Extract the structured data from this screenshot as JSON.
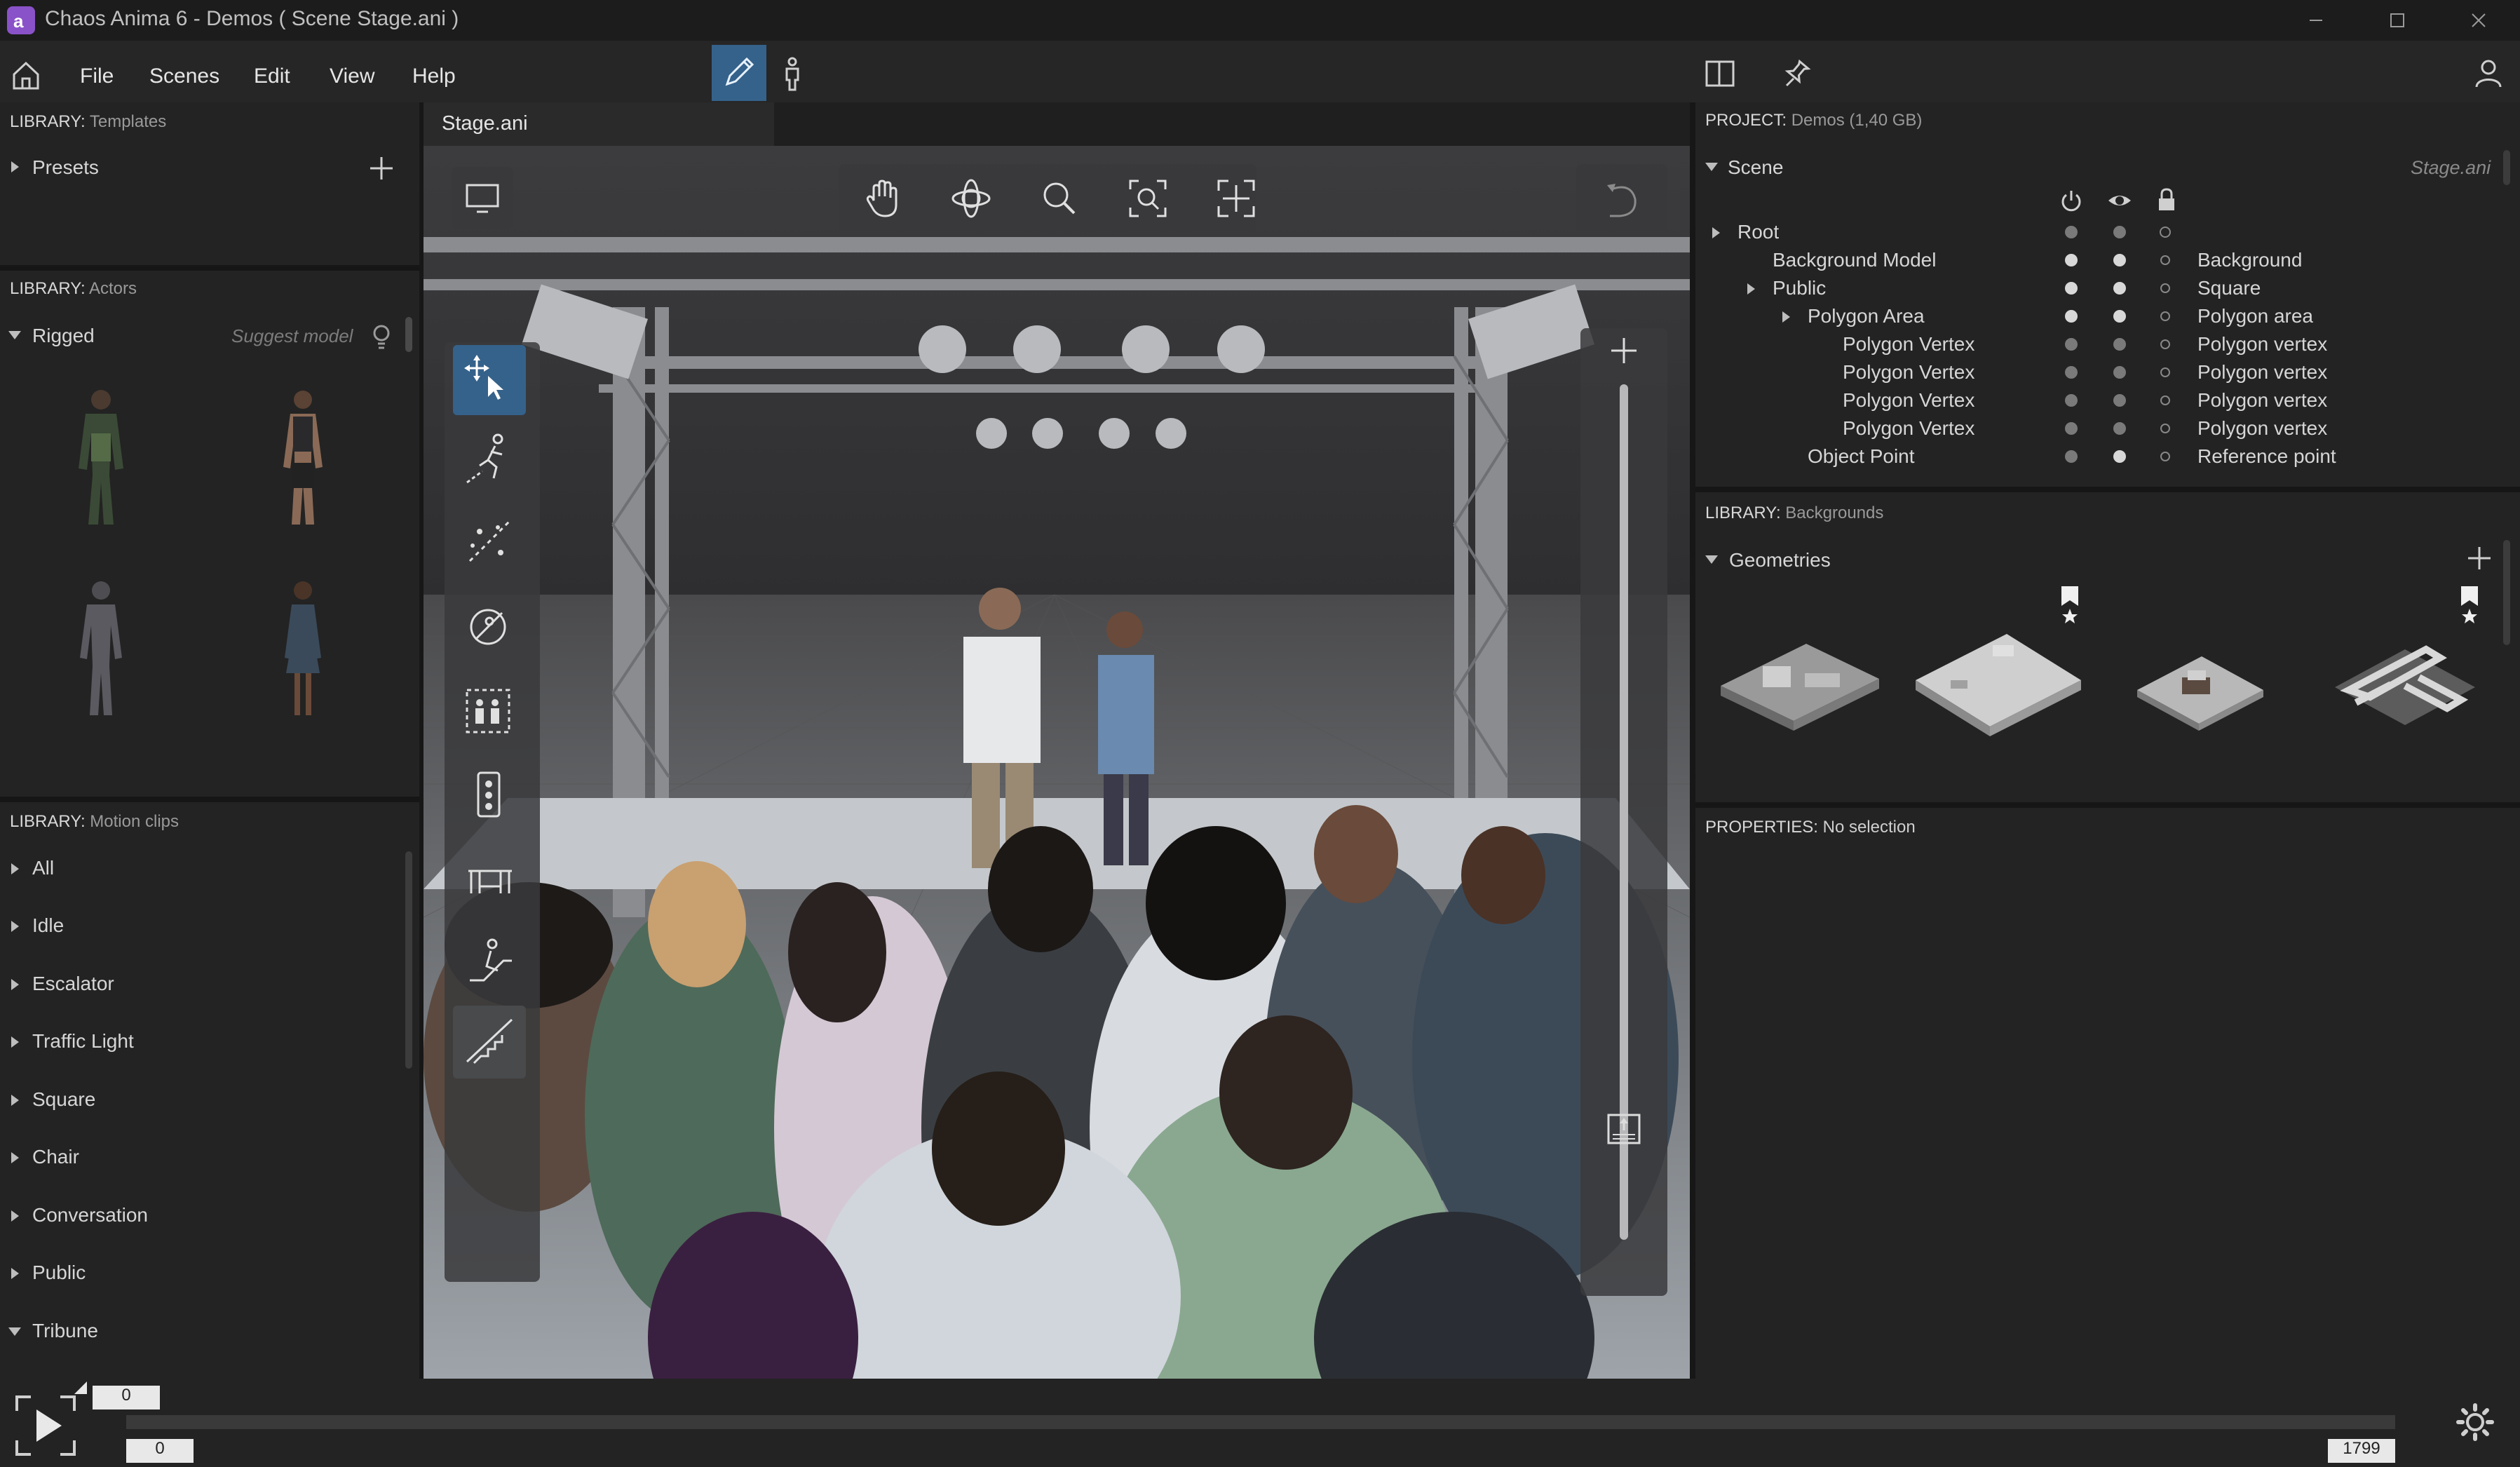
{
  "window": {
    "app_icon_glyph": "a",
    "title": "Chaos Anima 6 -   Demos ( Scene Stage.ani )"
  },
  "menu": {
    "file": "File",
    "scenes": "Scenes",
    "edit": "Edit",
    "view": "View",
    "help": "Help"
  },
  "left": {
    "templates": {
      "prefix": "LIBRARY:",
      "title": "Templates",
      "presets": "Presets"
    },
    "actors": {
      "prefix": "LIBRARY:",
      "title": "Actors",
      "rigged": "Rigged",
      "suggest": "Suggest model"
    },
    "motion": {
      "prefix": "LIBRARY:",
      "title": "Motion clips",
      "items": [
        "All",
        "Idle",
        "Escalator",
        "Traffic Light",
        "Square",
        "Chair",
        "Conversation",
        "Public",
        "Tribune"
      ]
    }
  },
  "viewport": {
    "tab_label": "Stage.ani"
  },
  "right": {
    "project": {
      "prefix": "PROJECT:",
      "title": "Demos (1,40 GB)"
    },
    "scene": {
      "label": "Scene",
      "file": "Stage.ani",
      "rows": [
        {
          "name": "Root",
          "type": ""
        },
        {
          "name": "Background Model",
          "type": "Background"
        },
        {
          "name": "Public",
          "type": "Square"
        },
        {
          "name": "Polygon Area",
          "type": "Polygon area"
        },
        {
          "name": "Polygon Vertex",
          "type": "Polygon vertex"
        },
        {
          "name": "Polygon Vertex",
          "type": "Polygon vertex"
        },
        {
          "name": "Polygon Vertex",
          "type": "Polygon vertex"
        },
        {
          "name": "Polygon Vertex",
          "type": "Polygon vertex"
        },
        {
          "name": "Object Point",
          "type": "Reference point"
        }
      ]
    },
    "backgrounds": {
      "prefix": "LIBRARY:",
      "title": "Backgrounds",
      "geometries": "Geometries"
    },
    "properties": {
      "prefix": "PROPERTIES:",
      "value": "No selection"
    }
  },
  "timeline": {
    "current_top": "0",
    "start": "0",
    "end": "1799"
  },
  "colors": {
    "accent": "#35628a",
    "app_icon": "#8a52c8",
    "background": "#1f1f1f",
    "panel": "#232323"
  }
}
